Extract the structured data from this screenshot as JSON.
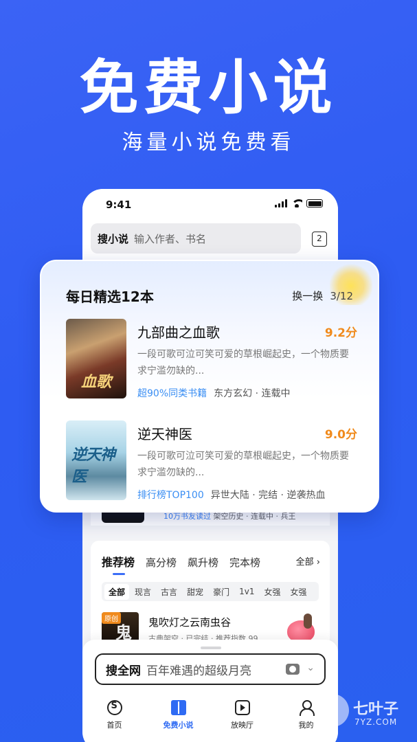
{
  "hero": {
    "title": "免费小说",
    "subtitle": "海量小说免费看"
  },
  "status": {
    "time": "9:41"
  },
  "search": {
    "label": "搜小说",
    "placeholder": "输入作者、书名",
    "tab_count": "2"
  },
  "daily": {
    "title": "每日精选12本",
    "refresh_label": "换一换",
    "page": "3/12",
    "books": [
      {
        "title": "九部曲之血歌",
        "score": "9.2分",
        "desc": "一段可歌可泣可笑可爱的草根崛起史，一个物质要求宁滥勿缺的...",
        "highlight": "超90%同类书籍",
        "tags": "东方玄幻 · 连载中",
        "cover_text": "血歌"
      },
      {
        "title": "逆天神医",
        "score": "9.0分",
        "desc": "一段可歌可泣可笑可爱的草根崛起史，一个物质要求宁滥勿缺的...",
        "highlight": "排行榜TOP100",
        "tags": "异世大陆 · 完结 · 逆袭热血",
        "cover_text": "逆天神医"
      }
    ]
  },
  "partial_row": {
    "highlight": "10万书友读过",
    "meta": "架空历史 · 连载中 · 兵王"
  },
  "rank": {
    "tabs": [
      "推荐榜",
      "高分榜",
      "飙升榜",
      "完本榜"
    ],
    "all_label": "全部 ›",
    "chips": [
      "全部",
      "现言",
      "古言",
      "甜宠",
      "豪门",
      "1v1",
      "女强",
      "女强"
    ],
    "book": {
      "tag": "原创",
      "cover_char": "鬼",
      "title": "鬼吹灯之云南虫谷",
      "meta": "古典架空 · 已完结 · 推荐指数 99"
    }
  },
  "bottom": {
    "search_label": "搜全网",
    "search_query": "百年难遇的超级月亮",
    "nav": [
      "首页",
      "免费小说",
      "放映厅",
      "我的"
    ]
  },
  "watermark": {
    "name": "七叶子",
    "url": "7YZ.COM"
  },
  "colors": {
    "background": "#2e5cf2",
    "accent": "#2f6bf3",
    "score": "#f08a1c",
    "highlight": "#3a8ef3"
  }
}
